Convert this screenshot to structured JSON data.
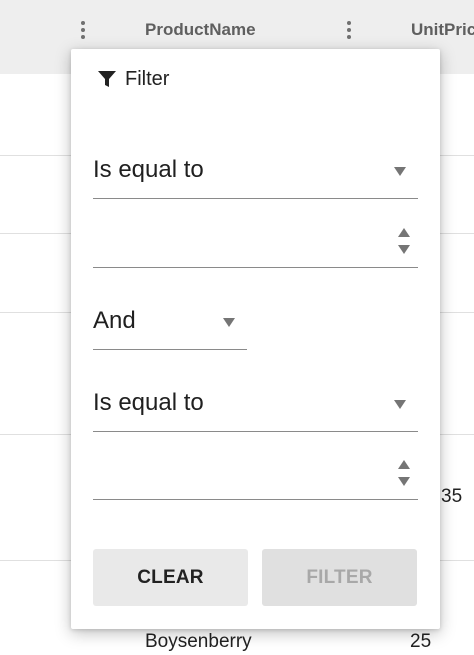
{
  "grid": {
    "columns": [
      {
        "title": "ProductName"
      },
      {
        "title": "UnitPric"
      }
    ],
    "visible_cells": {
      "partial_value": "35",
      "bottom_row_name": "Boysenberry",
      "bottom_row_value": "25"
    }
  },
  "filter_popup": {
    "title": "Filter",
    "icon": "funnel-icon",
    "first_condition": {
      "operator": "Is equal to",
      "value": ""
    },
    "logic": "And",
    "second_condition": {
      "operator": "Is equal to",
      "value": ""
    },
    "buttons": {
      "clear_label": "CLEAR",
      "filter_label": "FILTER"
    }
  }
}
